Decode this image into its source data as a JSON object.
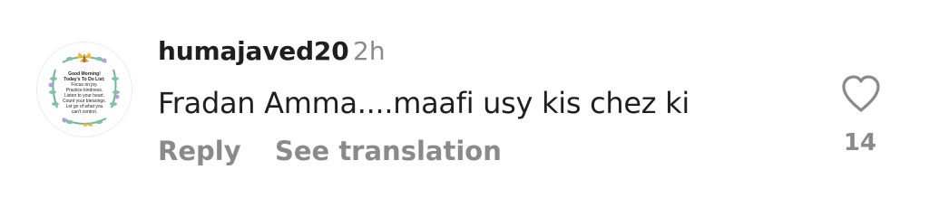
{
  "comment": {
    "username": "humajaved20",
    "time": "2h",
    "text": "Fradan Amma....maafi usy kis chez ki",
    "reply_label": "Reply",
    "translation_label": "See translation",
    "like_count": "14"
  },
  "avatar": {
    "lines": [
      "Good Morning!",
      "Today's To Do List:",
      "Focus on joy.",
      "Practice kindness.",
      "Listen to your heart.",
      "Count your blessings.",
      "Let go of what you",
      "can't control."
    ]
  },
  "colors": {
    "text": "#1f1f1f",
    "muted": "#8a8a8a",
    "background": "#ffffff"
  },
  "icons": {
    "like": "heart-outline-icon",
    "avatar_decoration": "butterfly-icon"
  }
}
